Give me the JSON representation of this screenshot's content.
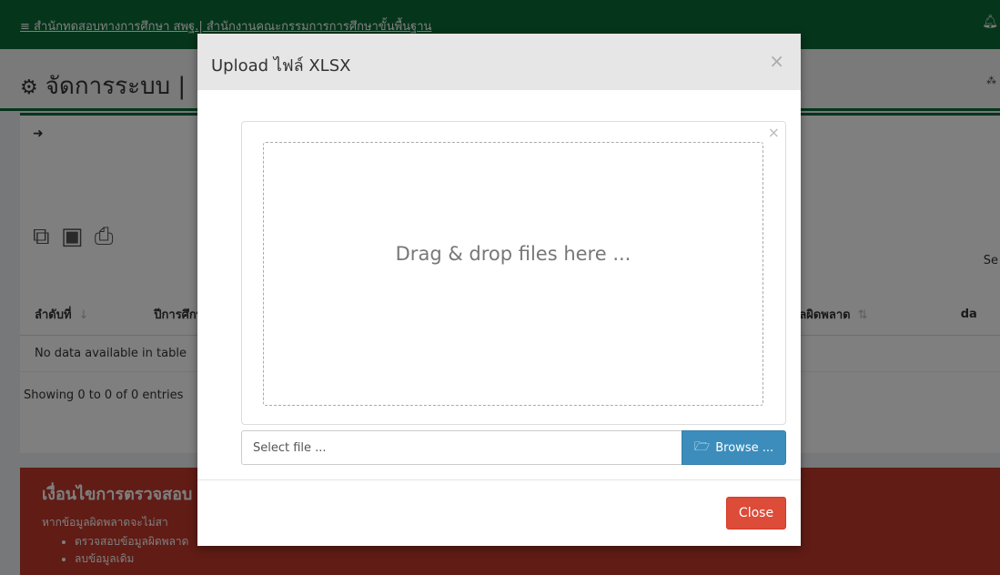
{
  "topbar": {
    "menu_icon": "hamburger-icon",
    "title": "≡ สำนักทดสอบทางการศึกษา สพฐ.| สำนักงานคณะกรรมการการศึกษาขั้นพื้นฐาน",
    "bell_icon": "bell-icon"
  },
  "page": {
    "title": "จัดการระบบ |",
    "title_icon": "gears-icon",
    "right_icon": "sitemap-icon"
  },
  "box": {
    "signin_icon": "sign-in-icon",
    "search_label": "Se",
    "table": {
      "columns": [
        "ลำดับที่",
        "ปีการศึกษ",
        "ข้อมูลผิดพลาด",
        "da"
      ],
      "empty_text": "No data available in table"
    },
    "info": "Showing 0 to 0 of 0 entries"
  },
  "callout": {
    "title": "เงื่อนไขการตรวจสอบ",
    "text": "หากข้อมูลผิดพลาดจะไม่สา",
    "items": [
      "ตรวจสอบข้อมูลผิดพลาด",
      "ลบข้อมูลเดิม"
    ]
  },
  "modal": {
    "title": "Upload ไฟล์ XLSX",
    "close_x": "×",
    "dropzone_close": "×",
    "dropzone_text": "Drag & drop files here ...",
    "file_placeholder": "Select file ...",
    "browse_label": "Browse ...",
    "browse_icon": "folder-open-icon",
    "close_label": "Close"
  },
  "colors": {
    "brand_green": "#0b6b37",
    "browse_blue": "#3c8dbc",
    "close_red": "#dd4b39",
    "callout_red": "#c0392b"
  }
}
